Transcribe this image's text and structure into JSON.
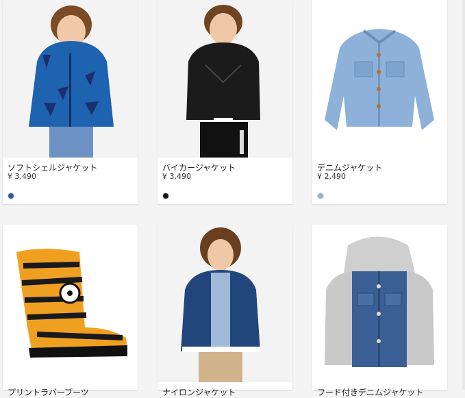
{
  "products": [
    {
      "name": "ソフトシェルジャケット",
      "price": "¥ 3,490",
      "swatch_color": "#2b5aa0",
      "image_icon": "softshell-jacket-photo"
    },
    {
      "name": "バイカージャケット",
      "price": "¥ 3,490",
      "swatch_color": "#1a1a1a",
      "image_icon": "biker-jacket-photo"
    },
    {
      "name": "デニムジャケット",
      "price": "¥ 2,490",
      "swatch_color": "#8fb1dc",
      "image_icon": "denim-jacket-photo"
    },
    {
      "name": "プリントラバーブーツ",
      "price": "",
      "swatch_color": "",
      "image_icon": "rubber-boots-photo"
    },
    {
      "name": "ナイロンジャケット",
      "price": "",
      "swatch_color": "",
      "image_icon": "nylon-jacket-photo"
    },
    {
      "name": "フード付きデニムジャケット",
      "price": "",
      "swatch_color": "",
      "image_icon": "hooded-denim-jacket-photo"
    }
  ]
}
